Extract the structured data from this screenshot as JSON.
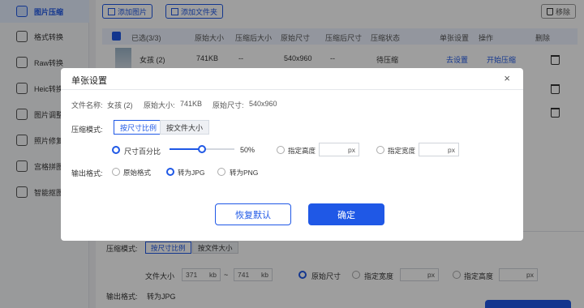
{
  "sidebar": {
    "items": [
      {
        "label": "图片压缩",
        "icon": "image-compress-icon",
        "active": true
      },
      {
        "label": "格式转换",
        "icon": "format-convert-icon"
      },
      {
        "label": "Raw转换",
        "icon": "raw-convert-icon"
      },
      {
        "label": "Heic转换",
        "icon": "heic-convert-icon"
      },
      {
        "label": "图片调整",
        "icon": "image-adjust-icon"
      },
      {
        "label": "照片修复",
        "icon": "photo-repair-icon"
      },
      {
        "label": "宫格拼图",
        "icon": "grid-collage-icon"
      },
      {
        "label": "智能抠图",
        "icon": "smart-cutout-icon"
      }
    ]
  },
  "toolbar": {
    "add_image": "添加图片",
    "add_folder": "添加文件夹",
    "remove": "移除"
  },
  "table": {
    "headers": {
      "selected": "已选(3/3)",
      "orig_size": "原始大小",
      "comp_size": "压缩后大小",
      "orig_dim": "原始尺寸",
      "comp_dim": "压缩后尺寸",
      "status": "压缩状态",
      "settings": "单张设置",
      "action": "操作",
      "delete": "删除"
    },
    "rows": [
      {
        "name": "女孩 (2)",
        "orig_size": "741KB",
        "comp_size": "--",
        "orig_dim": "540x960",
        "comp_dim": "--",
        "status": "待压缩",
        "settings": "去设置",
        "action": "开始压缩"
      }
    ]
  },
  "bottom": {
    "mode_label": "压缩模式:",
    "tab_ratio": "按尺寸比例",
    "tab_filesize": "按文件大小",
    "filesize_label": "文件大小",
    "min_value": "371",
    "max_value": "741",
    "unit_kb": "kb",
    "range_sep": "~",
    "opt_orig": "原始尺寸",
    "opt_width": "指定宽度",
    "opt_height": "指定高度",
    "unit_px": "px",
    "output_label": "输出格式:",
    "output_value": "转为JPG"
  },
  "dialog": {
    "title": "单张设置",
    "close": "×",
    "file_name_label": "文件名称:",
    "file_name": "女孩 (2)",
    "orig_size_label": "原始大小:",
    "orig_size": "741KB",
    "orig_dim_label": "原始尺寸:",
    "orig_dim": "540x960",
    "mode_label": "压缩模式:",
    "tab_ratio": "按尺寸比例",
    "tab_filesize": "按文件大小",
    "percent_label": "尺寸百分比",
    "percent_value": "50%",
    "percent_level": 0.5,
    "height_label": "指定高度",
    "width_label": "指定宽度",
    "unit_px": "px",
    "output_label": "输出格式:",
    "out_orig": "原始格式",
    "out_jpg": "转为JPG",
    "out_png": "转为PNG",
    "reset_button": "恢复默认",
    "confirm_button": "确定"
  },
  "colors": {
    "accent": "#1f58e6"
  }
}
